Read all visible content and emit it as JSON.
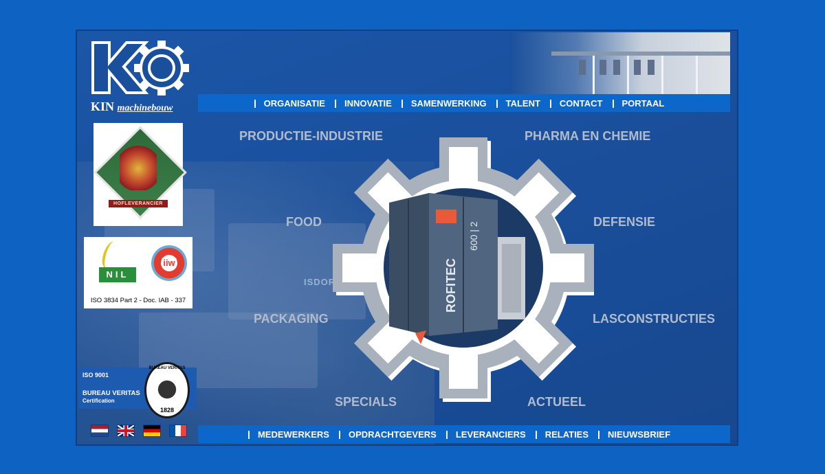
{
  "logo": {
    "brand": "KIN",
    "tagline": "machinebouw"
  },
  "nav_top": [
    "ORGANISATIE",
    "INNOVATIE",
    "SAMENWERKING",
    "TALENT",
    "CONTACT",
    "PORTAAL"
  ],
  "nav_bottom": [
    "MEDEWERKERS",
    "OPDRACHTGEVERS",
    "LEVERANCIERS",
    "RELATIES",
    "NIEUWSBRIEF"
  ],
  "sectors": {
    "productie": "PRODUCTIE-INDUSTRIE",
    "pharma": "PHARMA EN CHEMIE",
    "food": "FOOD",
    "defensie": "DEFENSIE",
    "packaging": "PACKAGING",
    "lasconstructies": "LASCONSTRUCTIES",
    "specials": "SPECIALS",
    "actueel": "ACTUEEL"
  },
  "royal_badge": {
    "ribbon": "HOFLEVERANCIER"
  },
  "cert_badge": {
    "nil": "NIL",
    "iiw": "iiw",
    "caption": "ISO 3834 Part 2 - Doc. IAB - 337"
  },
  "bv_badge": {
    "iso": "ISO 9001",
    "line1": "BUREAU VERITAS",
    "line2": "Certification",
    "seal_top": "BUREAU VERITAS",
    "year": "1828"
  },
  "machine": {
    "label": "ROFITEC",
    "model": "600 | 2"
  },
  "background_brand": "ISDORF",
  "colors": {
    "page_bg": "#0e63c2",
    "panel_bg": "#1a4f9c",
    "navbar": "#0d66c9",
    "sector_text": "#b0bccc"
  }
}
